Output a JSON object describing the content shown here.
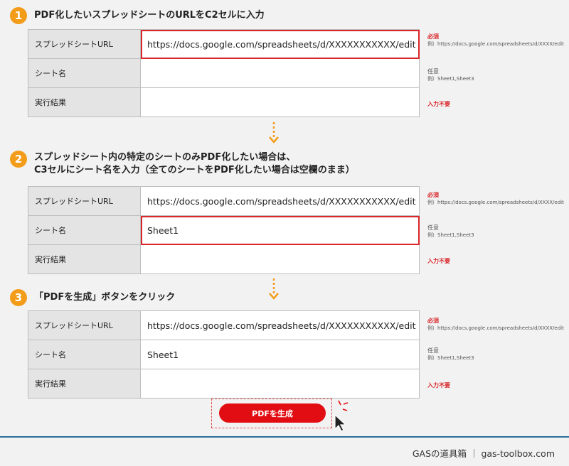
{
  "steps": [
    {
      "number": "1",
      "title_lines": [
        "PDF化したいスプレッドシートのURLをC2セルに入力"
      ],
      "rows": [
        {
          "label": "スプレッドシートURL",
          "value": "https://docs.google.com/spreadsheets/d/XXXXXXXXXXX/edit",
          "highlighted": true
        },
        {
          "label": "シート名",
          "value": "",
          "highlighted": false
        },
        {
          "label": "実行結果",
          "value": "",
          "highlighted": false
        }
      ]
    },
    {
      "number": "2",
      "title_lines": [
        "スプレッドシート内の特定のシートのみPDF化したい場合は、",
        "C3セルにシート名を入力（全てのシートをPDF化したい場合は空欄のまま）"
      ],
      "rows": [
        {
          "label": "スプレッドシートURL",
          "value": "https://docs.google.com/spreadsheets/d/XXXXXXXXXXX/edit",
          "highlighted": false
        },
        {
          "label": "シート名",
          "value": "Sheet1",
          "highlighted": true
        },
        {
          "label": "実行結果",
          "value": "",
          "highlighted": false
        }
      ]
    },
    {
      "number": "3",
      "title_lines": [
        "「PDFを生成」ボタンをクリック"
      ],
      "rows": [
        {
          "label": "スプレッドシートURL",
          "value": "https://docs.google.com/spreadsheets/d/XXXXXXXXXXX/edit",
          "highlighted": false
        },
        {
          "label": "シート名",
          "value": "Sheet1",
          "highlighted": false
        },
        {
          "label": "実行結果",
          "value": "",
          "highlighted": false
        }
      ]
    }
  ],
  "notes": {
    "url": {
      "tag": "必須",
      "example": "例）https://docs.google.com/spreadsheets/d/XXXX/edit"
    },
    "sheet": {
      "tag": "任意",
      "example": "例）Sheet1,Sheet3"
    },
    "result": {
      "tag": "入力不要"
    }
  },
  "generate_button": {
    "label": "PDFを生成"
  },
  "footer": {
    "text": "GASの道具箱 ｜ gas-toolbox.com"
  },
  "colors": {
    "step_badge": "#f39c19",
    "highlight": "#d9262a",
    "button": "#e20d12",
    "footer_line": "#2a6f97"
  },
  "icons": {
    "down_arrow": "dashed-down-arrow-icon",
    "cursor": "mouse-pointer-icon",
    "click_burst": "click-burst-icon"
  }
}
